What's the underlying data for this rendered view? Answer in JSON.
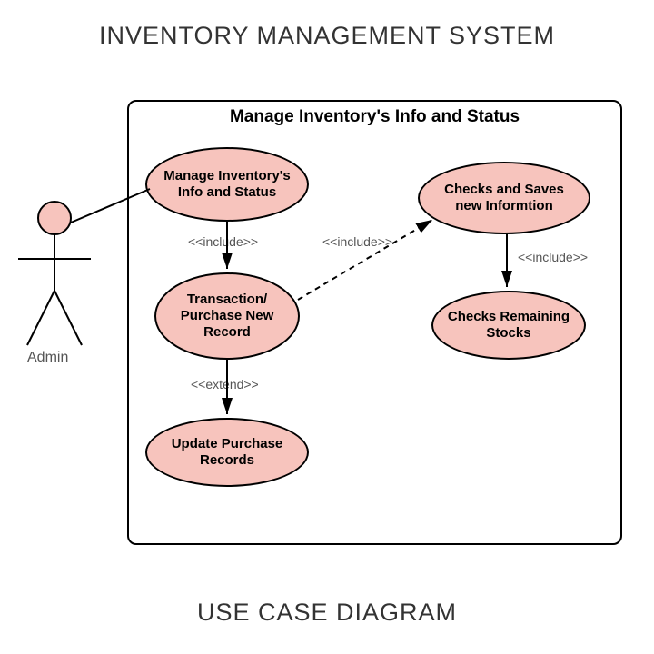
{
  "title": "INVENTORY MANAGEMENT SYSTEM",
  "footer": "USE CASE DIAGRAM",
  "system_label": "Manage Inventory's Info and Status",
  "actor": {
    "name": "Admin"
  },
  "usecases": {
    "uc1": "Manage Inventory's Info and Status",
    "uc2": "Transaction/ Purchase New Record",
    "uc3": "Update Purchase Records",
    "uc4": "Checks and Saves new Informtion",
    "uc5": "Checks Remaining Stocks"
  },
  "relationships": {
    "r1": "<<include>>",
    "r2": "<<include>>",
    "r3": "<<extend>>",
    "r4": "<<include>>"
  }
}
